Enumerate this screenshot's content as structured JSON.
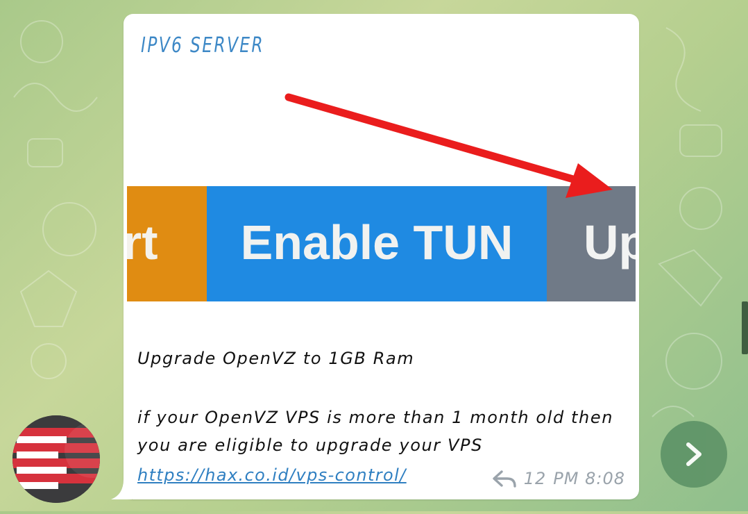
{
  "message": {
    "channel_name": "IPV6 SERVER",
    "preview": {
      "left_button_fragment": "rt",
      "center_button_label": "Enable TUN",
      "right_button_fragment": "Up",
      "colors": {
        "left": "#e08c12",
        "center": "#1f8ae2",
        "right": "#707a87",
        "arrow": "#ea1d1d"
      }
    },
    "text_line1": "Upgrade OpenVZ to 1GB Ram",
    "text_line2": "if your OpenVZ VPS is more than 1 month old then",
    "text_line3": "you are eligible to upgrade your VPS",
    "link": "https://hax.co.id/vps-control/",
    "reply_count": "12",
    "time": "PM 8:08"
  },
  "icons": {
    "reply": "reply-arrow-icon",
    "next": "chevron-right-icon"
  },
  "theme": {
    "accent": "#3d88c6",
    "nav_button": "#5e9467"
  }
}
